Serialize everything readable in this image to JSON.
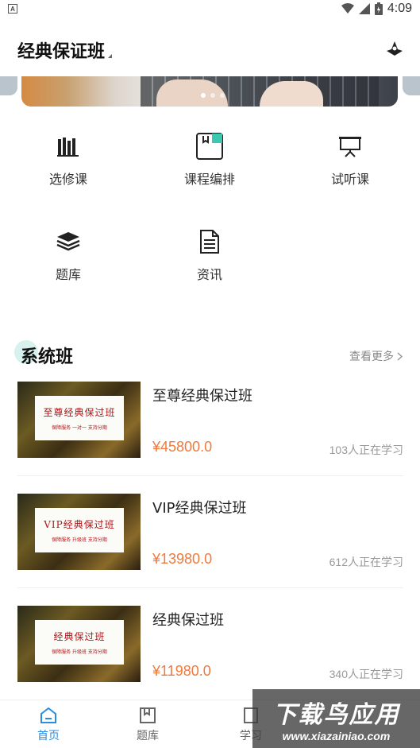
{
  "status_bar": {
    "time": "4:09",
    "left_icon": "A"
  },
  "header": {
    "title": "经典保证班"
  },
  "banner": {
    "slides": 3,
    "active_slide": 1
  },
  "quick_links": [
    {
      "label": "选修课",
      "icon": "books-icon"
    },
    {
      "label": "课程编排",
      "icon": "bookmark-board-icon"
    },
    {
      "label": "试听课",
      "icon": "presentation-icon"
    },
    {
      "label": "题库",
      "icon": "stack-icon"
    },
    {
      "label": "资讯",
      "icon": "document-icon"
    }
  ],
  "section": {
    "title": "系统班",
    "more_label": "查看更多"
  },
  "courses": [
    {
      "name": "至尊经典保过班",
      "price": "¥45800.0",
      "learners": "103人正在学习",
      "thumb_title": "至尊经典保过班",
      "thumb_sub": "保障服务 一对一 支持分期"
    },
    {
      "name": "VIP经典保过班",
      "price": "¥13980.0",
      "learners": "612人正在学习",
      "thumb_title": "VIP经典保过班",
      "thumb_sub": "保障服务 升级班 支持分期"
    },
    {
      "name": "经典保过班",
      "price": "¥11980.0",
      "learners": "340人正在学习",
      "thumb_title": "经典保过班",
      "thumb_sub": "保障服务 升级班 支持分期"
    }
  ],
  "bottom_nav": [
    {
      "label": "首页",
      "icon": "home-icon",
      "active": true
    },
    {
      "label": "题库",
      "icon": "question-bank-icon",
      "active": false
    },
    {
      "label": "学习",
      "icon": "study-icon",
      "active": false
    }
  ],
  "watermark": {
    "main": "下载鸟应用",
    "sub": "www.xiazainiao.com"
  },
  "colors": {
    "accent": "#2a8de0",
    "price": "#f07a3c",
    "section_bubble": "#d7f2ee"
  }
}
